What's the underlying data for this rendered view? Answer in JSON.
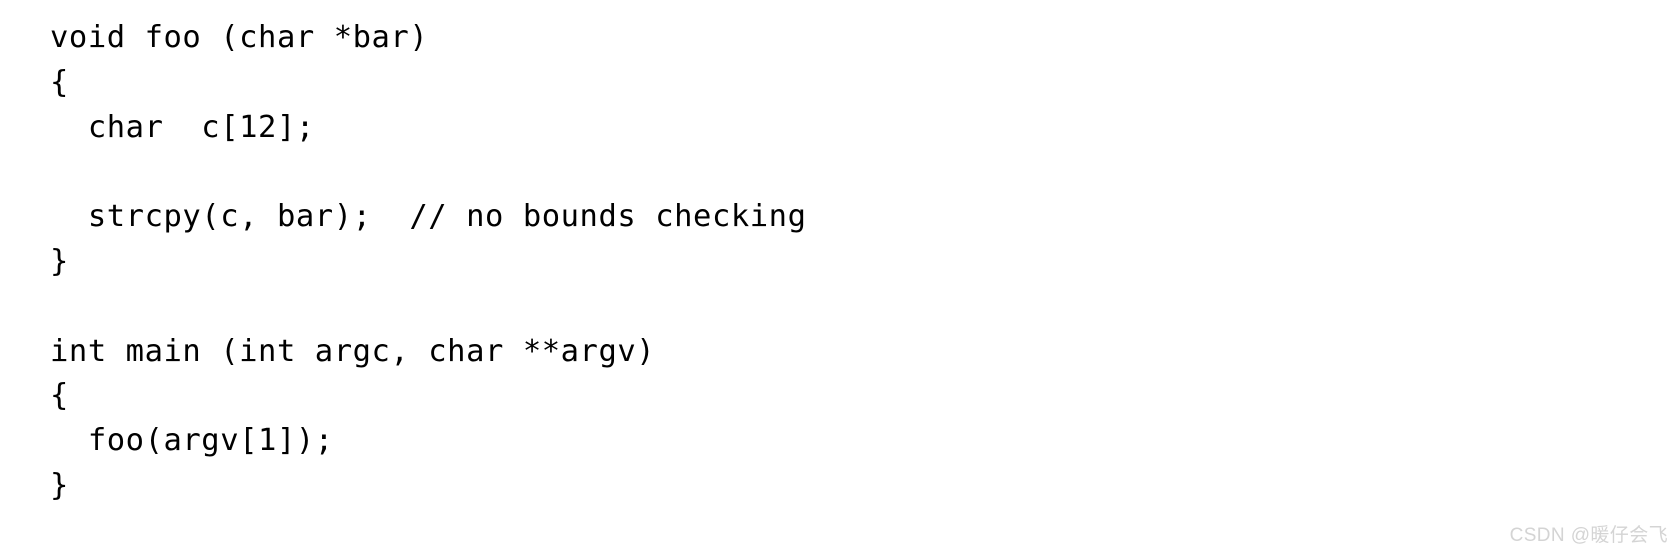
{
  "figure": {
    "kind": "code-listing",
    "language": "C",
    "background_color": "#ffffff",
    "text_color": "#000000"
  },
  "code": {
    "lines": [
      "void foo (char *bar)",
      "{",
      "  char  c[12];",
      "",
      "  strcpy(c, bar);  // no bounds checking",
      "}",
      "",
      "int main (int argc, char **argv)",
      "{",
      "  foo(argv[1]);",
      "}"
    ],
    "full_text": "void foo (char *bar)\n{\n  char  c[12];\n\n  strcpy(c, bar);  // no bounds checking\n}\n\nint main (int argc, char **argv)\n{\n  foo(argv[1]);\n}"
  },
  "watermark": {
    "text": "CSDN @暖仔会飞",
    "color": "#d4d4d4"
  }
}
